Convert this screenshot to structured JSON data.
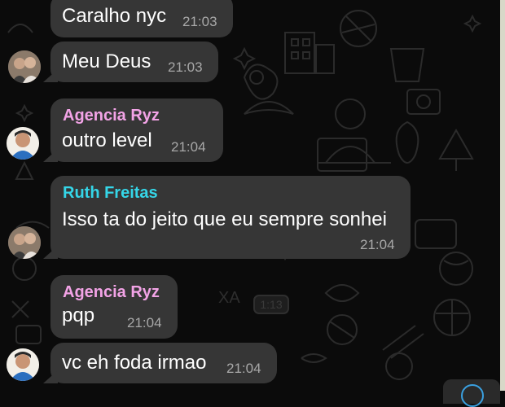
{
  "messages": [
    {
      "text": "Caralho nyc",
      "time": "21:03"
    },
    {
      "text": "Meu Deus",
      "time": "21:03"
    },
    {
      "sender": "Agencia Ryz",
      "sender_color": "#f2a3e6",
      "text": "outro level",
      "time": "21:04"
    },
    {
      "sender": "Ruth Freitas",
      "sender_color": "#35d6e8",
      "text": "Isso ta do jeito que eu sempre sonhei",
      "time": "21:04"
    },
    {
      "sender": "Agencia Ryz",
      "sender_color": "#f2a3e6",
      "text": "pqp",
      "time": "21:04"
    },
    {
      "text": "vc eh foda irmao",
      "time": "21:04"
    }
  ],
  "wallpaper_text": {
    "badge": "1:13",
    "letters": "XA"
  },
  "colors": {
    "bubble": "#363636",
    "background": "#0b0b0b",
    "timestamp": "#a8a8a8",
    "accent": "#3aa0e0"
  }
}
